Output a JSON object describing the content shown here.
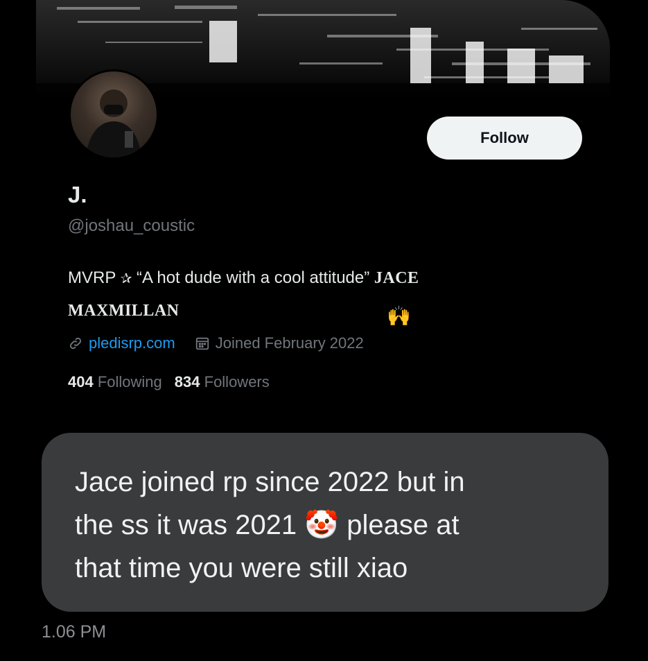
{
  "profile": {
    "display_name": "J.",
    "handle": "@joshau_coustic",
    "follow_label": "Follow",
    "bio": {
      "part1": "MVRP ",
      "star": "✰",
      "part2": " “A hot dude with a cool attitude” ",
      "name_line1": "JACE",
      "name_line2": "MAXMILLAN",
      "emoji": "🙌"
    },
    "website": "pledisrp.com",
    "joined": "Joined February 2022",
    "following_count": "404",
    "following_label": "Following",
    "followers_count": "834",
    "followers_label": "Followers"
  },
  "message": {
    "line1": "Jace joined rp since 2022 but in",
    "line2a": "the ss it was 2021 ",
    "emoji": "🤡",
    "line2b": " please at",
    "line3": "that time you were still xiao",
    "timestamp": "1.06 PM"
  },
  "colors": {
    "background": "#000000",
    "bubble": "#3a3b3d",
    "link": "#1d9bf0",
    "secondary_text": "#71767b"
  }
}
